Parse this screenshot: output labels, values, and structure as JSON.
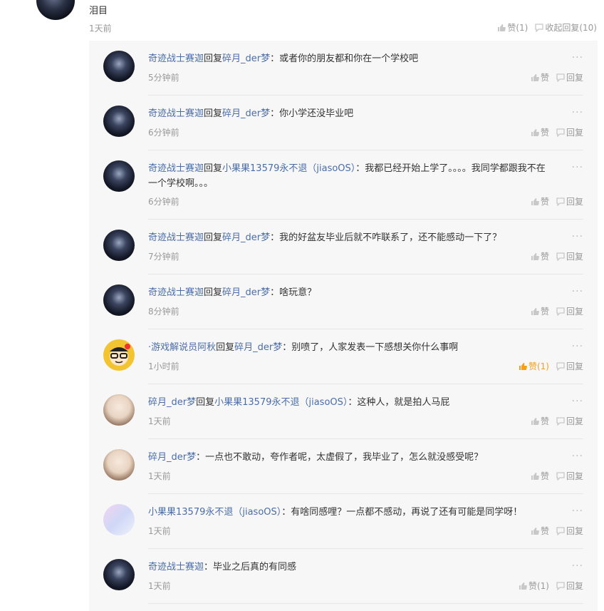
{
  "top": {
    "text": "泪目",
    "time": "1天前",
    "like_label": "赞(1)",
    "collapse_label": "收起回复(10)"
  },
  "replies": [
    {
      "user": "奇迹战士赛迦",
      "connector": "回复",
      "target": "碎月_der梦",
      "content": "：或者你的朋友都和你在一个学校吧",
      "time": "5分钟前",
      "like": "赞",
      "reply": "回复"
    },
    {
      "user": "奇迹战士赛迦",
      "connector": "回复",
      "target": "碎月_der梦",
      "content": "：你小学还没毕业吧",
      "time": "6分钟前",
      "like": "赞",
      "reply": "回复"
    },
    {
      "user": "奇迹战士赛迦",
      "connector": "回复",
      "target": "小果果13579永不退（jiasoOS）",
      "content": "：我都已经开始上学了。。。。我同学都跟我不在一个学校啊。。。",
      "time": "6分钟前",
      "like": "赞",
      "reply": "回复"
    },
    {
      "user": "奇迹战士赛迦",
      "connector": "回复",
      "target": "碎月_der梦",
      "content": "：我的好盆友毕业后就不咋联系了，还不能感动一下了？",
      "time": "7分钟前",
      "like": "赞",
      "reply": "回复"
    },
    {
      "user": "奇迹战士赛迦",
      "connector": "回复",
      "target": "碎月_der梦",
      "content": "：啥玩意？",
      "time": "8分钟前",
      "like": "赞",
      "reply": "回复"
    },
    {
      "user": "·游戏解说员阿秋",
      "connector": "回复",
      "target": "碎月_der梦",
      "content": "：别喷了，人家发表一下感想关你什么事啊",
      "time": "1小时前",
      "like": "赞(1)",
      "reply": "回复"
    },
    {
      "user": "碎月_der梦",
      "connector": "回复",
      "target": "小果果13579永不退（jiasoOS）",
      "content": "：这种人，就是拍人马屁",
      "time": "1天前",
      "like": "赞",
      "reply": "回复"
    },
    {
      "user": "碎月_der梦",
      "connector": "",
      "target": "",
      "content": "：一点也不敢动，夸作者呢，太虚假了，我毕业了，怎么就没感受呢？",
      "time": "1天前",
      "like": "赞",
      "reply": "回复"
    },
    {
      "user": "小果果13579永不退（jiasoOS）",
      "connector": "",
      "target": "",
      "content": "：有啥同感哩？一点都不感动，再说了还有可能是同学呀！",
      "time": "1天前",
      "like": "赞",
      "reply": "回复"
    },
    {
      "user": "奇迹战士赛迦",
      "connector": "",
      "target": "",
      "content": "：毕业之后真的有同感",
      "time": "1天前",
      "like": "赞(1)",
      "reply": "回复"
    }
  ],
  "icons": {
    "like": "thumbs-up-icon",
    "reply": "comment-bubble-icon",
    "more": "more-dots-icon"
  },
  "colors": {
    "name": "#4a6da8",
    "muted": "#999999",
    "liked": "#f2a119",
    "panel": "#f7f7f7"
  }
}
